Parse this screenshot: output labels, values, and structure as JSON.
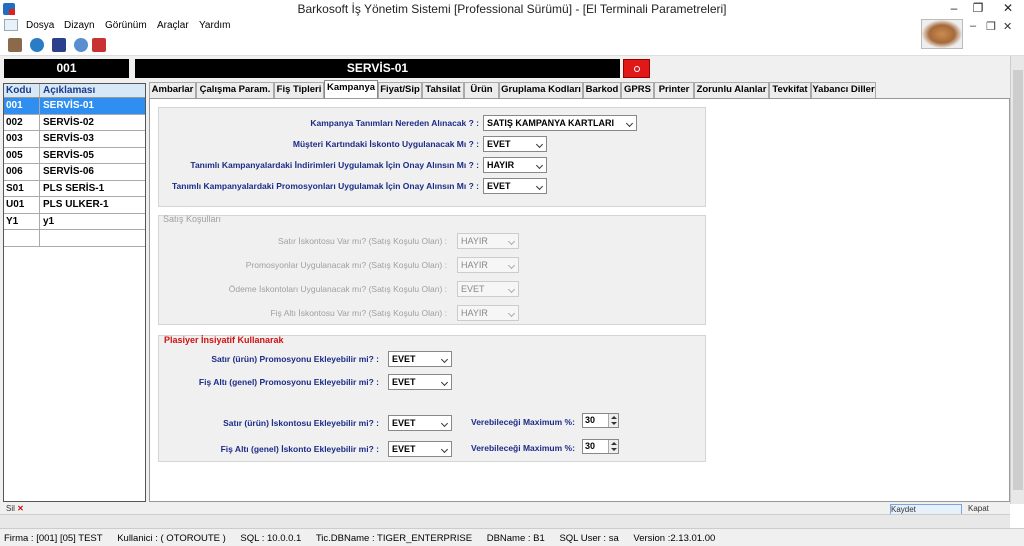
{
  "window": {
    "title": "Barkosoft İş Yönetim Sistemi [Professional Sürümü] - [El Terminali Parametreleri]",
    "min_glyph": "–",
    "max_glyph": "❐",
    "close_glyph": "✕"
  },
  "menu": {
    "items": [
      "Dosya",
      "Dizayn",
      "Görünüm",
      "Araçlar",
      "Yardım"
    ],
    "mdi_min": "–",
    "mdi_restore": "❐",
    "mdi_close": "✕"
  },
  "toolbar": {
    "icons": [
      "users-icon",
      "globe-icon",
      "cash-register-icon",
      "network-icon",
      "exit-icon"
    ]
  },
  "header": {
    "code": "001",
    "name": "SERVİS-01"
  },
  "grid": {
    "columns": [
      "Kodu",
      "Açıklaması"
    ],
    "rows": [
      {
        "code": "001",
        "desc": "SERVİS-01",
        "selected": true
      },
      {
        "code": "002",
        "desc": "SERVİS-02"
      },
      {
        "code": "003",
        "desc": "SERVİS-03"
      },
      {
        "code": "005",
        "desc": "SERVİS-05"
      },
      {
        "code": "006",
        "desc": "SERVİS-06"
      },
      {
        "code": "S01",
        "desc": "PLS SERİS-1"
      },
      {
        "code": "U01",
        "desc": "PLS ULKER-1"
      },
      {
        "code": "Y1",
        "desc": "y1"
      },
      {
        "code": "",
        "desc": ""
      }
    ]
  },
  "tabs": [
    "Ambarlar",
    "Çalışma Param.",
    "Fiş Tipleri",
    "Kampanya",
    "Fiyat/Sip",
    "Tahsilat",
    "Ürün",
    "Gruplama Kodları",
    "Barkod",
    "GPRS",
    "Printer",
    "Zorunlu Alanlar",
    "Tevkifat",
    "Yabancı Diller"
  ],
  "active_tab": "Kampanya",
  "campaign": {
    "q1": {
      "label": "Kampanya Tanımları Nereden Alınacak ? :",
      "value": "SATIŞ KAMPANYA KARTLARI"
    },
    "q2": {
      "label": "Müşteri Kartındaki İskonto Uygulanacak Mı ? :",
      "value": "EVET"
    },
    "q3": {
      "label": "Tanımlı Kampanyalardaki İndirimleri  Uygulamak İçin Onay Alınsın Mı ? :",
      "value": "HAYIR"
    },
    "q4": {
      "label": "Tanımlı Kampanyalardaki Promosyonları Uygulamak İçin Onay Alınsın Mı ? :",
      "value": "EVET"
    }
  },
  "sales": {
    "title": "Satış Koşulları",
    "q1": {
      "label": "Satır İskontosu Var mı? (Satış Koşulu Olan) :",
      "value": "HAYIR"
    },
    "q2": {
      "label": "Promosyonlar Uygulanacak mı?  (Satış Koşulu Olan) :",
      "value": "HAYIR"
    },
    "q3": {
      "label": "Ödeme İskontoları Uygulanacak mı?  (Satış Koşulu Olan) :",
      "value": "EVET"
    },
    "q4": {
      "label": "Fiş Altı İskontosu Var mı? (Satış Koşulu Olan) :",
      "value": "HAYIR"
    }
  },
  "plasiyer": {
    "title": "Plasiyer İnsiyatif Kullanarak",
    "q1": {
      "label": "Satır (ürün) Promosyonu Ekleyebilir mi? :",
      "value": "EVET"
    },
    "q2": {
      "label": "Fiş Altı  (genel) Promosyonu Ekleyebilir mi? :",
      "value": "EVET"
    },
    "q3": {
      "label": "Satır (ürün) İskontosu Ekleyebilir mi? :",
      "value": "EVET",
      "max_label": "Verebileceği Maximum %:",
      "max_value": "30"
    },
    "q4": {
      "label": "Fiş Altı (genel) İskonto Ekleyebilir mi? :",
      "value": "EVET",
      "max_label": "Verebileceği Maximum %:",
      "max_value": "30"
    }
  },
  "bottom": {
    "left_btn": "Sil",
    "right_btn1": "Kaydet",
    "right_btn2": "Kapat"
  },
  "status": {
    "firma": "Firma : [001] [05]  TEST",
    "kullanici": "Kullanici : ( OTOROUTE )",
    "sql": "SQL : 10.0.0.1",
    "tic": "Tic.DBName : TIGER_ENTERPRISE",
    "db": "DBName : B1",
    "sqluser": "SQL User : sa",
    "version": "Version :2.13.01.00"
  }
}
